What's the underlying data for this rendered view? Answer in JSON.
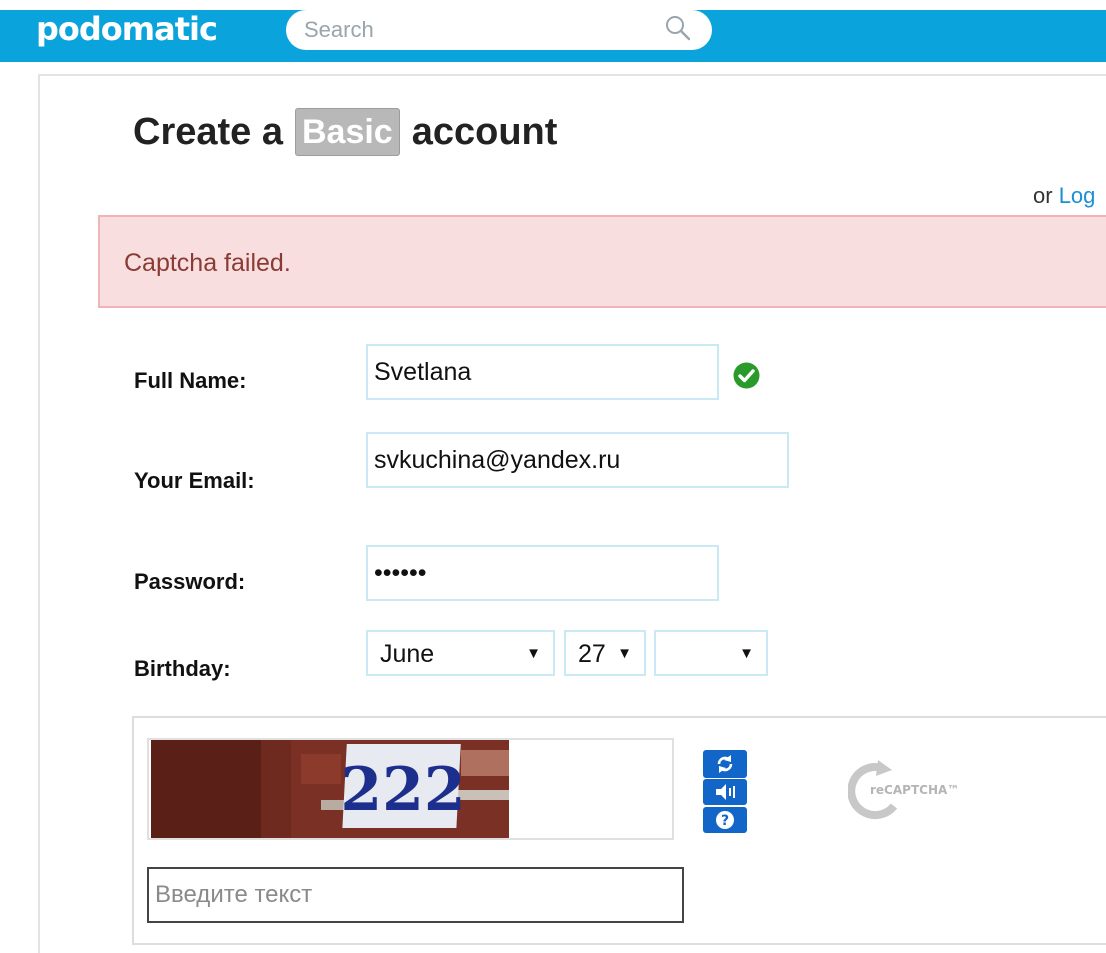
{
  "header": {
    "logo_text": "podomatic",
    "search_placeholder": "Search",
    "search_icon": "search-icon",
    "brand_color": "#0aa3dc"
  },
  "page": {
    "title_prefix": "Create a",
    "title_badge": "Basic",
    "title_suffix": "account",
    "login_prefix": "or",
    "login_link": "Log"
  },
  "alert": {
    "message": "Captcha failed.",
    "background_color": "#f8dede",
    "text_color": "#8a3b35"
  },
  "form": {
    "full_name_label": "Full Name:",
    "full_name_value": "Svetlana",
    "full_name_status_icon": "check-circle-icon",
    "email_label": "Your Email:",
    "email_value": "svkuchina@yandex.ru",
    "password_label": "Password:",
    "password_value": "••••••",
    "birthday_label": "Birthday:",
    "birthday_month": "June",
    "birthday_day": "27",
    "birthday_year": ""
  },
  "captcha": {
    "challenge_text": "222",
    "input_placeholder": "Введите текст",
    "refresh_icon": "refresh-icon",
    "audio_icon": "audio-icon",
    "help_icon": "help-icon",
    "logo_text": "reCAPTCHA™"
  }
}
